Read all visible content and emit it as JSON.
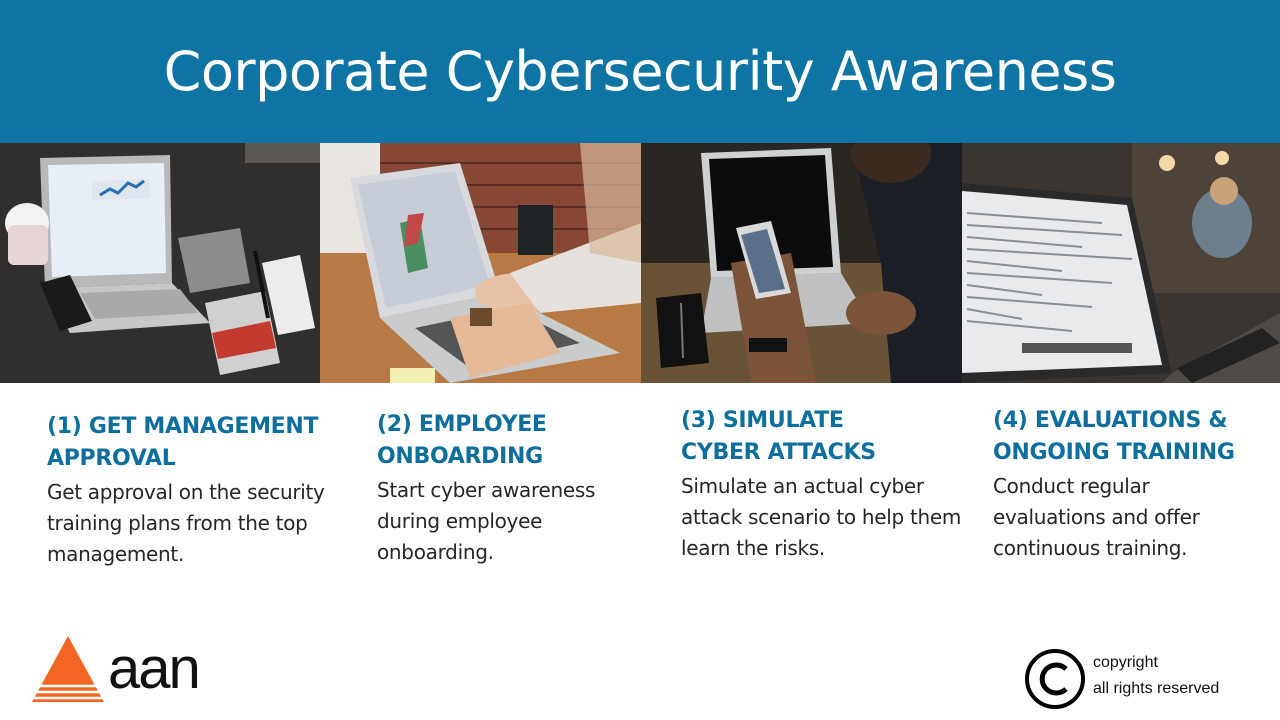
{
  "slide": {
    "title": "Corporate Cybersecurity Awareness"
  },
  "steps": [
    {
      "title": "(1) GET MANAGEMENT\nAPPROVAL",
      "description": "Get approval on the security\ntraining  plans from the top\nmanagement."
    },
    {
      "title": "(2) EMPLOYEE\nONBOARDING",
      "description": "Start cyber awareness\nduring employee\nonboarding."
    },
    {
      "title": "(3) SIMULATE\n CYBER ATTACKS",
      "description": "Simulate an actual  cyber\nattack scenario to help them\nlearn the risks."
    },
    {
      "title": "(4) EVALUATIONS &\nONGOING TRAINING",
      "description": "Conduct regular\nevaluations and offer\ncontinuous training."
    }
  ],
  "photos": [
    {
      "icon": "laptop-desk-photo",
      "caption": "",
      "accent": "#2a2a2a"
    },
    {
      "icon": "laptop-typing-photo",
      "caption": "",
      "accent": "#8a4a35"
    },
    {
      "icon": "phone-laptop-photo",
      "caption": "",
      "accent": "#5a4630"
    },
    {
      "icon": "code-laptop-photo",
      "caption": "",
      "accent": "#3a3a3a"
    }
  ],
  "logo": {
    "text": "aan",
    "accent": "#f26522"
  },
  "footer": {
    "copyright_symbol": "©",
    "copyright_line1": "copyright",
    "copyright_line2": "all rights reserved"
  },
  "colors": {
    "header_bg": "#0e74a3",
    "step_title": "#0e6e9e",
    "body_text": "#262626"
  }
}
